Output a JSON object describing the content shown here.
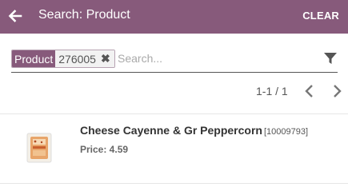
{
  "header": {
    "title": "Search: Product",
    "clear_label": "CLEAR",
    "background": "#875a7b",
    "back_icon": "arrow-left-icon"
  },
  "search": {
    "facet_label": "Product",
    "facet_value": "276005",
    "remove_icon": "close-icon",
    "placeholder": "Search...",
    "value": "",
    "filter_icon": "filter-icon"
  },
  "pager": {
    "value": "1-1 / 1",
    "prev_icon": "chevron-left-icon",
    "next_icon": "chevron-right-icon"
  },
  "records": [
    {
      "name": "Cheese Cayenne & Gr Peppercorn",
      "code": "[10009793]",
      "price_label": "Price: 4.59",
      "image_icon": "product-thumbnail"
    }
  ]
}
